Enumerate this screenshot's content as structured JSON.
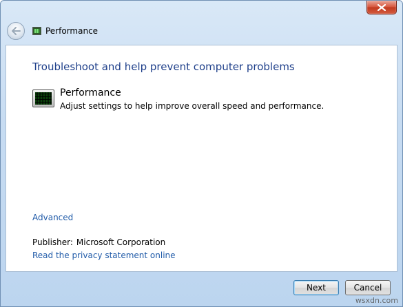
{
  "window": {
    "title": "Performance"
  },
  "content": {
    "heading": "Troubleshoot and help prevent computer problems",
    "task": {
      "title": "Performance",
      "description": "Adjust settings to help improve overall speed and performance.",
      "icon": "performance-monitor-icon"
    },
    "advanced_link": "Advanced",
    "publisher_label": "Publisher:",
    "publisher_value": "Microsoft Corporation",
    "privacy_link": "Read the privacy statement online"
  },
  "buttons": {
    "next": "Next",
    "cancel": "Cancel"
  },
  "watermark": "wsxdn.com",
  "colors": {
    "heading": "#1e3f8a",
    "link": "#1f5aa8",
    "chrome": "#c7dcf2",
    "close": "#c0391f"
  }
}
